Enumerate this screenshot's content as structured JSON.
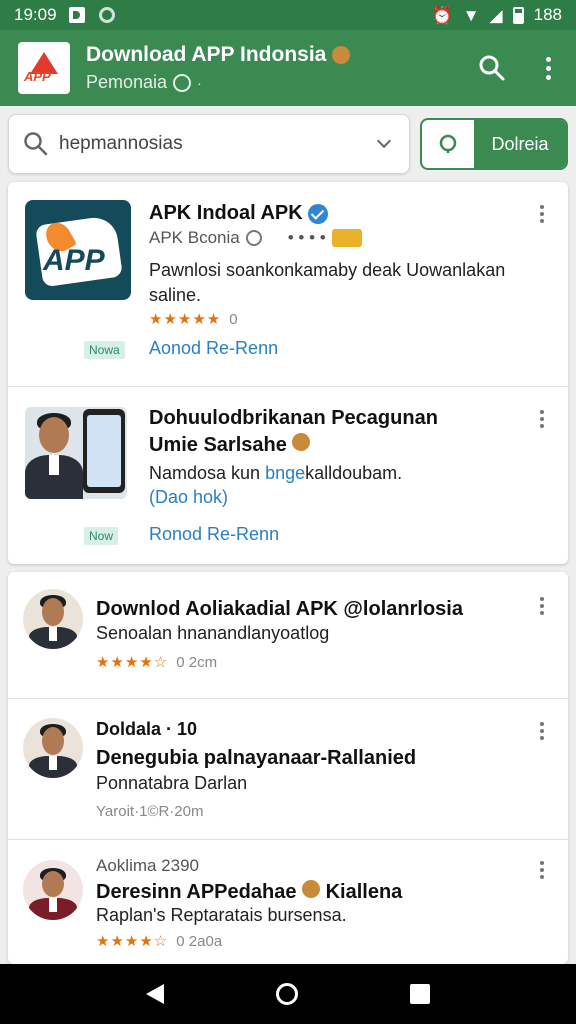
{
  "status_bar": {
    "time": "19:09",
    "battery_text": "188"
  },
  "app_bar": {
    "title": "Download APP Indonsia",
    "subtitle": "Pemonaia",
    "logo_text": "APP"
  },
  "search": {
    "value": "hepmannosias",
    "button_label": "Dolreia"
  },
  "featured": [
    {
      "title": "APK Indoal APK",
      "meta": "APK Bconia",
      "meta_dots": "• • • •",
      "desc": "Pawnlosi soankonkamaby deak Uowanlakan saline.",
      "stars": "★★★★★",
      "rating": "0",
      "badge": "Nowa",
      "link": "Aonod Re-Renn",
      "icon_text": "APP"
    },
    {
      "title_line1": "Dohuulodbrikanan Pecagunan",
      "title_line2": "Umie Sarlsahe",
      "desc_pre": "Namdosa kun ",
      "desc_highlight": "bnge",
      "desc_post": "kalldoubam.",
      "desc_link": "(Dao hok)",
      "badge": "Now",
      "link": "Ronod Re-Renn"
    }
  ],
  "results": [
    {
      "title": "Downlod Aoliakadial APK @lolanrlosia",
      "sub": "Senoalan hnanandlanyoatlog",
      "stars": "★★★★☆",
      "meta": "0 2cm"
    },
    {
      "title_small": "Doldala · 10",
      "title": "Denegubia palnayanaar-Rallanied",
      "sub": "Ponnatabra Darlan",
      "meta": "Yaroit·1©R·20m"
    },
    {
      "title_small": "Aoklima 2390",
      "title": "Deresinn APPedahae",
      "title_tail": "Kiallena",
      "sub": "Raplan's Reptaratais bursensa.",
      "stars": "★★★★☆",
      "meta": "0 2a0a"
    }
  ],
  "colors": {
    "primary": "#3b8a52",
    "status": "#2e7d46",
    "link": "#2a7fc3",
    "star": "#e8710a"
  },
  "icons": [
    "search-icon",
    "more-vert-icon",
    "chevron-down-icon",
    "verified-icon",
    "back-icon",
    "home-icon",
    "recents-icon"
  ]
}
